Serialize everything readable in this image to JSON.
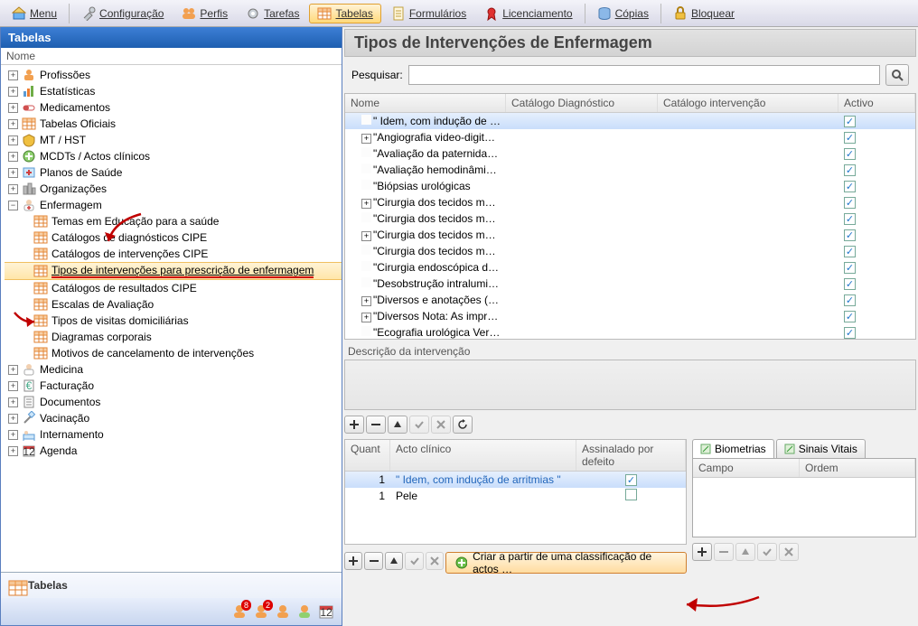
{
  "toolbar": {
    "menu": "Menu",
    "config": "Configuração",
    "perfis": "Perfis",
    "tarefas": "Tarefas",
    "tabelas": "Tabelas",
    "formularios": "Formulários",
    "licenciamento": "Licenciamento",
    "copias": "Cópias",
    "bloquear": "Bloquear"
  },
  "sidebar": {
    "title": "Tabelas",
    "header": "Nome",
    "items": [
      {
        "label": "Profissões",
        "exp": "+"
      },
      {
        "label": "Estatísticas",
        "exp": "+"
      },
      {
        "label": "Medicamentos",
        "exp": "+"
      },
      {
        "label": "Tabelas Oficiais",
        "exp": "+"
      },
      {
        "label": "MT / HST",
        "exp": "+"
      },
      {
        "label": "MCDTs / Actos clínicos",
        "exp": "+"
      },
      {
        "label": "Planos de Saúde",
        "exp": "+"
      },
      {
        "label": "Organizações",
        "exp": "+"
      },
      {
        "label": "Enfermagem",
        "exp": "-",
        "open": true
      },
      {
        "label": "Medicina",
        "exp": "+"
      },
      {
        "label": "Facturação",
        "exp": "+"
      },
      {
        "label": "Documentos",
        "exp": "+"
      },
      {
        "label": "Vacinação",
        "exp": "+"
      },
      {
        "label": "Internamento",
        "exp": "+"
      },
      {
        "label": "Agenda",
        "exp": "+"
      }
    ],
    "enfChildren": [
      "Temas em Educação para a saúde",
      "Catálogos de diagnósticos CIPE",
      "Catálogos de intervenções CIPE",
      "Tipos de intervenções para prescrição de enfermagem",
      "Catálogos de resultados CIPE",
      "Escalas de Avaliação",
      "Tipos de visitas domiciliárias",
      "Diagramas corporais",
      "Motivos de cancelamento de intervenções"
    ],
    "footerLabel": "Tabelas",
    "badges": [
      "8",
      "2"
    ]
  },
  "page": {
    "title": "Tipos de Intervenções de Enfermagem",
    "searchLabel": "Pesquisar:",
    "cols": {
      "nome": "Nome",
      "cd": "Catálogo Diagnóstico",
      "ci": "Catálogo intervenção",
      "act": "Activo"
    },
    "rows": [
      {
        "n": "\" Idem, com indução de arrit…",
        "exp": "",
        "sel": true
      },
      {
        "n": "\"Angiografia video-digital de …",
        "exp": "+"
      },
      {
        "n": "\"Avaliação da paternidade, í…",
        "exp": ""
      },
      {
        "n": "\"Avaliação hemodinâmica art…",
        "exp": ""
      },
      {
        "n": "\"Biópsias urológicas",
        "exp": ""
      },
      {
        "n": "\"Cirurgia dos tecidos moles",
        "exp": "+"
      },
      {
        "n": "\"Cirurgia dos tecidos moles",
        "exp": ""
      },
      {
        "n": "\"Cirurgia dos tecidos moles",
        "exp": "+"
      },
      {
        "n": "\"Cirurgia dos tecidos moles",
        "exp": ""
      },
      {
        "n": "\"Cirurgia endoscópica do seg…",
        "exp": ""
      },
      {
        "n": "\"Desobstrução intraluminal c…",
        "exp": ""
      },
      {
        "n": "\"Diversos e anotações (inclui …",
        "exp": "+"
      },
      {
        "n": "\"Diversos Nota: As impressõ…",
        "exp": "+"
      },
      {
        "n": "\"Ecografia urológica Ver Cod.…",
        "exp": ""
      }
    ],
    "descLabel": "Descrição da intervenção",
    "acto": {
      "cols": {
        "q": "Quant",
        "a": "Acto clínico",
        "d": "Assinalado por defeito"
      },
      "rows": [
        {
          "q": "1",
          "a": "\" Idem, com indução de arritmias \"",
          "chk": true,
          "sel": true
        },
        {
          "q": "1",
          "a": "Pele",
          "chk": false
        }
      ]
    },
    "tabs": {
      "bio": "Biometrias",
      "sv": "Sinais Vitais",
      "campo": "Campo",
      "ordem": "Ordem"
    },
    "createBtn": "Criar a partir de uma classificação de actos …"
  }
}
